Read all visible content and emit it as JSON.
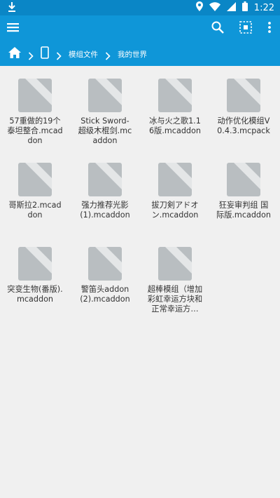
{
  "status_bar": {
    "time": "1:22"
  },
  "toolbar": {
    "icons": [
      "menu-icon",
      "search-icon",
      "select-all-icon",
      "more-vert-icon"
    ]
  },
  "breadcrumb": {
    "items": [
      "home-icon",
      "phone-icon",
      "模组文件",
      "我的世界"
    ],
    "folder": "模组文件",
    "current": "我的世界"
  },
  "files": [
    {
      "name": "57重做的19个泰坦整合.mcaddon"
    },
    {
      "name": "Stick Sword-超级木棍剑.mcaddon"
    },
    {
      "name": "冰与火之歌1.16版.mcaddon"
    },
    {
      "name": "动作优化模组V0.4.3.mcpack"
    },
    {
      "name": "哥斯拉2.mcaddon"
    },
    {
      "name": "强力推荐光影(1).mcaddon"
    },
    {
      "name": "拔刀剣アドオン.mcaddon"
    },
    {
      "name": "狂妄审判组 国际版.mcaddon"
    },
    {
      "name": "突变生物(番版).mcaddon"
    },
    {
      "name": "警笛头addon(2).mcaddon"
    },
    {
      "name": "超棒模组（增加彩虹幸运方块和正常幸运方…"
    }
  ],
  "colors": {
    "status_bar": "#0a86c6",
    "toolbar": "#0f96d8",
    "thumb_bg": "#b9bec1",
    "thumb_fold": "#e4e6e7"
  }
}
